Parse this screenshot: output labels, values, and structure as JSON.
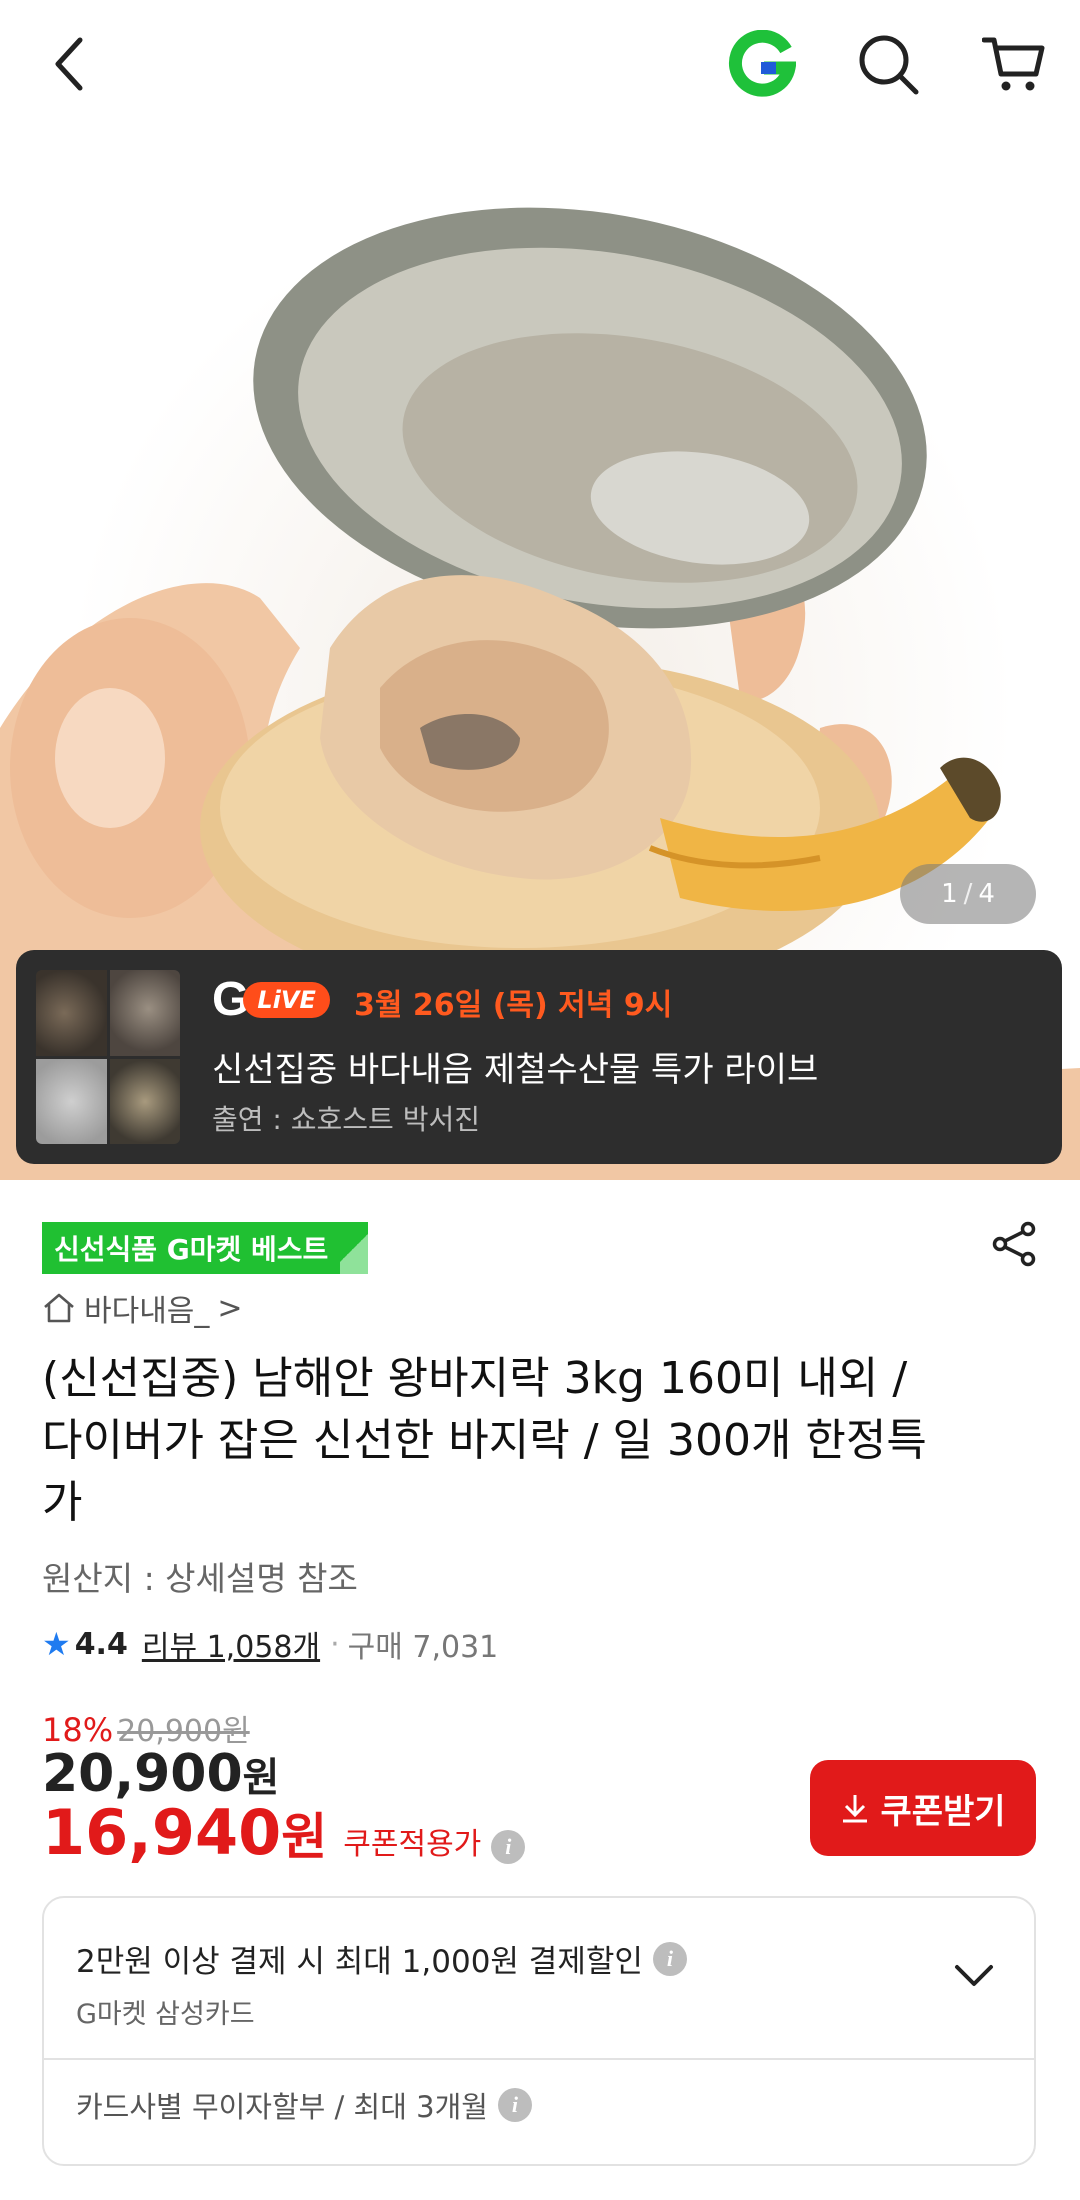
{
  "header": {
    "back_icon": "chevron-left-icon",
    "logo_icon": "gmarket-g-logo-icon",
    "search_icon": "search-icon",
    "cart_icon": "cart-icon"
  },
  "gallery": {
    "current": "1",
    "separator": "/",
    "total": "4"
  },
  "live": {
    "logo_text": "G",
    "badge": "LiVE",
    "date": "3월 26일 (목) 저녁 9시",
    "title": "신선집중 바다내음 제철수산물 특가 라이브",
    "host": "출연 : 쇼호스트 박서진"
  },
  "product": {
    "badge": "신선식품 G마켓 베스트",
    "shop_name": "바다내음_",
    "shop_arrow": ">",
    "title": "(신선집중) 남해안 왕바지락 3kg 160미 내외 / 다이버가 잡은 신선한 바지락 / 일 300개 한정특가",
    "origin": "원산지 : 상세설명 참조",
    "rating": "4.4",
    "reviews": "리뷰 1,058개",
    "dot": "·",
    "purchases": "구매 7,031",
    "discount_rate": "18%",
    "original_price": "20,900원",
    "price": "20,900",
    "price_unit": "원",
    "coupon_price": "16,940",
    "coupon_unit": "원",
    "coupon_label": "쿠폰적용가",
    "info_symbol": "i",
    "coupon_button": "쿠폰받기"
  },
  "benefits": {
    "card_discount": "2만원 이상 결제 시 최대 1,000원 결제할인",
    "card_name": "G마켓 삼성카드",
    "installment": "카드사별 무이자할부 / 최대 3개월"
  },
  "colors": {
    "accent_red": "#e11a1a",
    "live_orange": "#ff5a1f",
    "best_green": "#20c032",
    "star_blue": "#1f7bf0",
    "logo_green": "#1fc13a",
    "logo_blue": "#1f5bd8"
  }
}
